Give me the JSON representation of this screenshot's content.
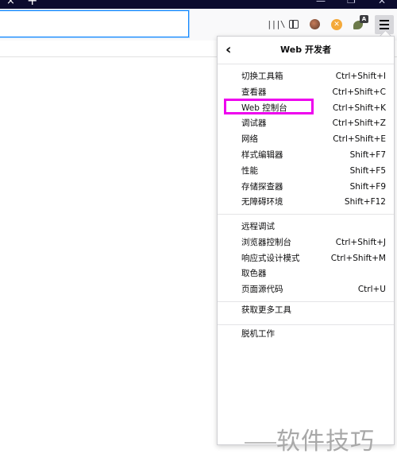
{
  "tabstrip": {
    "close_glyph": "×",
    "newtab_glyph": "+"
  },
  "window_controls": {
    "minimize": "—",
    "maximize": "❐",
    "close": "✕"
  },
  "toolbar": {
    "icons": [
      "library-icon",
      "sidebar-icon",
      "extension-icon",
      "extension-icon",
      "extension-icon",
      "menu-icon"
    ],
    "library_glyph": "|||\\",
    "ext2_glyph": "✕",
    "badge_text": "A",
    "accent_color": "#0a84ff"
  },
  "panel": {
    "back_glyph": "‹",
    "title": "Web 开发者",
    "groups": [
      [
        {
          "label": "切换工具箱",
          "shortcut": "Ctrl+Shift+I"
        },
        {
          "label": "查看器",
          "shortcut": "Ctrl+Shift+C"
        },
        {
          "label": "Web 控制台",
          "shortcut": "Ctrl+Shift+K"
        },
        {
          "label": "调试器",
          "shortcut": "Ctrl+Shift+Z"
        },
        {
          "label": "网络",
          "shortcut": "Ctrl+Shift+E"
        },
        {
          "label": "样式编辑器",
          "shortcut": "Shift+F7"
        },
        {
          "label": "性能",
          "shortcut": "Shift+F5"
        },
        {
          "label": "存储探查器",
          "shortcut": "Shift+F9"
        },
        {
          "label": "无障碍环境",
          "shortcut": "Shift+F12"
        }
      ],
      [
        {
          "label": "远程调试",
          "shortcut": ""
        },
        {
          "label": "浏览器控制台",
          "shortcut": "Ctrl+Shift+J"
        },
        {
          "label": "响应式设计模式",
          "shortcut": "Ctrl+Shift+M"
        },
        {
          "label": "取色器",
          "shortcut": ""
        },
        {
          "label": "页面源代码",
          "shortcut": "Ctrl+U"
        }
      ],
      [
        {
          "label": "获取更多工具",
          "shortcut": ""
        }
      ],
      [
        {
          "label": "脱机工作",
          "shortcut": ""
        }
      ]
    ],
    "highlight_color": "#ee00ee"
  },
  "watermark": {
    "text": "软件技巧"
  }
}
